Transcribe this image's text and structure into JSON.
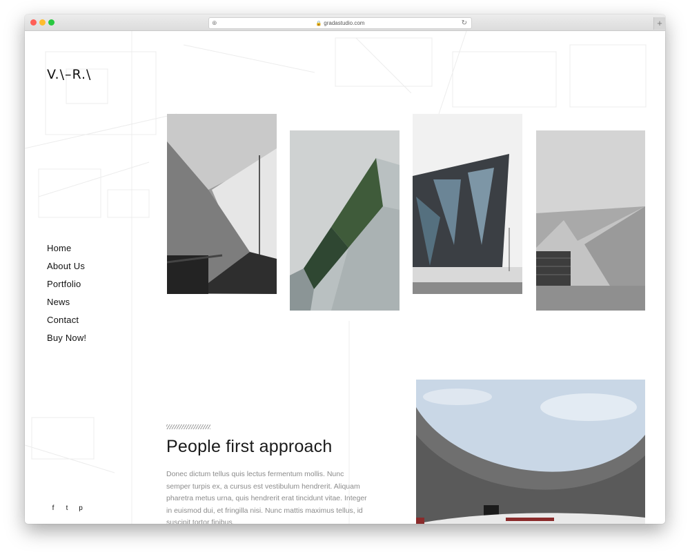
{
  "browser": {
    "url": "gradastudio.com",
    "traffic_lights": [
      "#ff5f57",
      "#febc2e",
      "#28c840"
    ],
    "new_tab_label": "+"
  },
  "site": {
    "logo": "V.\\–R.\\",
    "nav": [
      {
        "label": "Home"
      },
      {
        "label": "About Us"
      },
      {
        "label": "Portfolio"
      },
      {
        "label": "News"
      },
      {
        "label": "Contact"
      },
      {
        "label": "Buy Now!"
      }
    ],
    "social": [
      {
        "icon": "facebook-icon",
        "glyph": "f"
      },
      {
        "icon": "twitter-icon",
        "glyph": "t"
      },
      {
        "icon": "pinterest-icon",
        "glyph": "p"
      }
    ]
  },
  "section": {
    "heading": "People first approach",
    "text": "Donec dictum tellus quis lectus fermentum mollis. Nunc semper turpis ex, a cursus est vestibulum hendrerit. Aliquam pharetra metus urna, quis hendrerit erat tincidunt vitae. Integer in euismod dui, et fringilla nisi. Nunc mattis maximus tellus, id suscipit tortor finibus."
  }
}
